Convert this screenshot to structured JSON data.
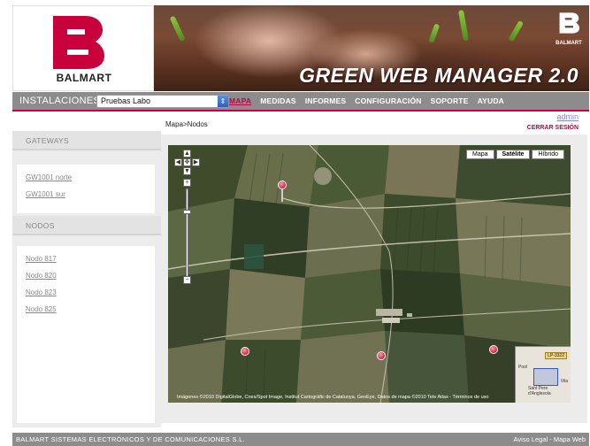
{
  "brand": {
    "logo_text": "BALMART",
    "banner_title": "GREEN WEB MANAGER 2.0",
    "banner_logo_text": "BALMART",
    "accent_color": "#c8004a"
  },
  "navbar": {
    "installations_label": "INSTALACIONES:",
    "installation_selected": "Pruebas Labo",
    "menu": [
      {
        "label": "MAPA",
        "active": true
      },
      {
        "label": "MEDIDAS",
        "active": false
      },
      {
        "label": "INFORMES",
        "active": false
      },
      {
        "label": "CONFIGURACIÓN",
        "active": false
      },
      {
        "label": "SOPORTE",
        "active": false
      },
      {
        "label": "AYUDA",
        "active": false
      }
    ]
  },
  "user": {
    "admin_label": "admin",
    "logout_label": "CERRAR SESIÓN"
  },
  "breadcrumb": "Mapa>Nodos",
  "sidebar": {
    "gateways_header": "GATEWAYS",
    "gateways": [
      "GW1001 norte",
      "GW1001 sur"
    ],
    "nodes_header": "NODOS",
    "nodes": [
      "Nodo 817",
      "Nodo 820",
      "Nodo 823",
      "Nodo 825"
    ]
  },
  "map": {
    "type_buttons": [
      "Mapa",
      "Satélite",
      "Híbrido"
    ],
    "active_type": "Satélite",
    "attribution": "Imágenes ©2010 DigitalGlobe, Cnes/Spot Image, Institut Cartogràfic de Catalunya, GeoEye, Datos de mapa ©2010 Tele Atlas - Términos de uso",
    "overview_badge": "LP-3322",
    "overview_labels": [
      "Pool",
      "Vila",
      "Sant Pere d'Anglesola"
    ]
  },
  "footer": {
    "company": "BALMART SISTEMAS ELECTRÓNICOS Y DE COMUNICACIONES S.L.",
    "legal": "Aviso Legal",
    "separator": " - ",
    "sitemap": "Mapa Web"
  }
}
